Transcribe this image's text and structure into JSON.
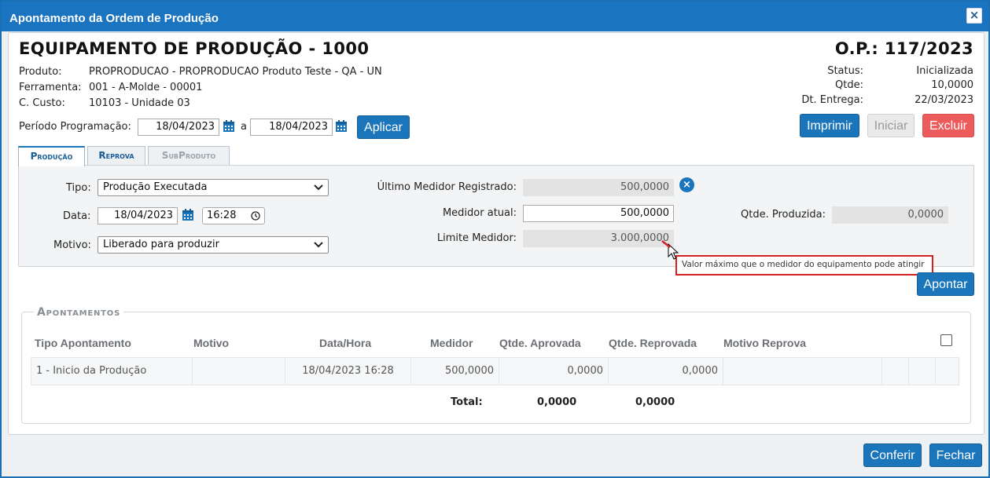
{
  "dialog": {
    "title": "Apontamento da Ordem de Produção",
    "close_label": "×"
  },
  "header": {
    "equipment_title": "EQUIPAMENTO DE PRODUÇÃO - 1000",
    "op_title": "O.P.: 117/2023",
    "produto_label": "Produto:",
    "produto_value": "PROPRODUCAO - PROPRODUCAO Produto Teste - QA - UN",
    "ferramenta_label": "Ferramenta:",
    "ferramenta_value": "001 - A-Molde - 00001",
    "custo_label": "C. Custo:",
    "custo_value": "10103 - Unidade 03",
    "status_label": "Status:",
    "status_value": "Inicializada",
    "qtde_label": "Qtde:",
    "qtde_value": "10,0000",
    "entrega_label": "Dt. Entrega:",
    "entrega_value": "22/03/2023"
  },
  "periodo": {
    "label": "Período Programação:",
    "from": "18/04/2023",
    "separator": "a",
    "to": "18/04/2023",
    "apply_label": "Aplicar"
  },
  "actions": {
    "imprimir": "Imprimir",
    "iniciar": "Iniciar",
    "excluir": "Excluir"
  },
  "tabs": [
    {
      "label": "Produção",
      "active": true
    },
    {
      "label": "Reprova",
      "active": false
    },
    {
      "label": "SubProduto",
      "active": false,
      "disabled": true
    }
  ],
  "form": {
    "tipo_label": "Tipo:",
    "tipo_value": "Produção Executada",
    "data_label": "Data:",
    "data_value": "18/04/2023",
    "hora_value": "16:28",
    "motivo_label": "Motivo:",
    "motivo_value": "Liberado para produzir",
    "ultimo_label": "Último Medidor Registrado:",
    "ultimo_value": "500,0000",
    "medidor_label": "Medidor atual:",
    "medidor_value": "500,0000",
    "limite_label": "Limite Medidor:",
    "limite_value": "3.000,0000",
    "produzida_label": "Qtde. Produzida:",
    "produzida_value": "0,0000",
    "tooltip": "Valor máximo que o medidor do equipamento pode atingir",
    "apontar_label": "Apontar"
  },
  "apontamentos": {
    "legend": "Apontamentos",
    "columns": [
      "Tipo Apontamento",
      "Motivo",
      "Data/Hora",
      "Medidor",
      "Qtde. Aprovada",
      "Qtde. Reprovada",
      "Motivo Reprova"
    ],
    "rows": [
      {
        "tipo": "1 - Inicio da Produção",
        "motivo": "",
        "datahora": "18/04/2023 16:28",
        "medidor": "500,0000",
        "aprovada": "0,0000",
        "reprovada": "0,0000",
        "motivo_reprova": ""
      }
    ],
    "total_label": "Total:",
    "total_aprovada": "0,0000",
    "total_reprovada": "0,0000"
  },
  "footer": {
    "conferir": "Conferir",
    "fechar": "Fechar"
  },
  "colors": {
    "accent": "#1b75bb",
    "danger": "#ee5b5b",
    "tooltip_border": "#d42222"
  }
}
